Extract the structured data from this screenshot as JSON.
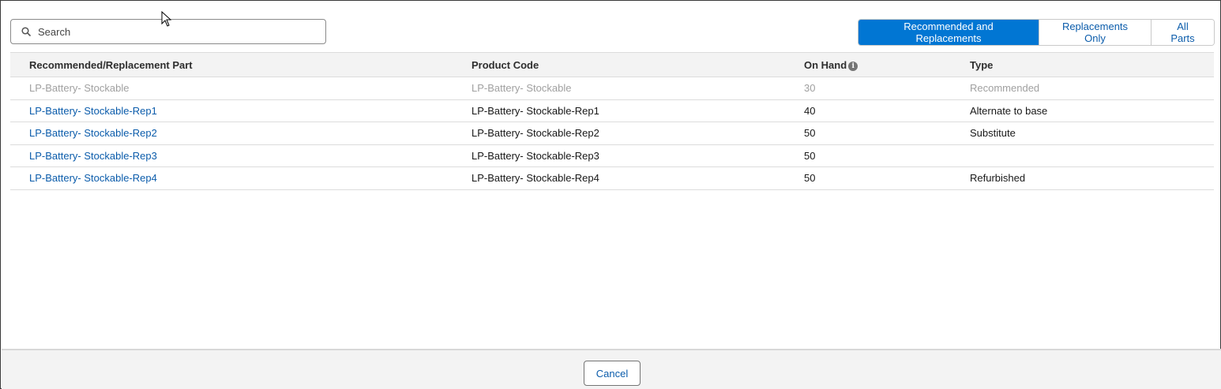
{
  "search": {
    "placeholder": "Search",
    "value": ""
  },
  "filters": {
    "options": [
      "Recommended and Replacements",
      "Replacements Only",
      "All Parts"
    ],
    "selected": "Recommended and Replacements"
  },
  "table": {
    "columns": [
      "Recommended/Replacement Part",
      "Product Code",
      "On Hand",
      "Type"
    ],
    "rows": [
      {
        "part": "LP-Battery- Stockable",
        "code": "LP-Battery- Stockable",
        "on_hand": "30",
        "type": "Recommended",
        "disabled": true
      },
      {
        "part": "LP-Battery- Stockable-Rep1",
        "code": "LP-Battery- Stockable-Rep1",
        "on_hand": "40",
        "type": "Alternate to base",
        "disabled": false
      },
      {
        "part": "LP-Battery- Stockable-Rep2",
        "code": "LP-Battery- Stockable-Rep2",
        "on_hand": "50",
        "type": "Substitute",
        "disabled": false
      },
      {
        "part": "LP-Battery- Stockable-Rep3",
        "code": "LP-Battery- Stockable-Rep3",
        "on_hand": "50",
        "type": "",
        "disabled": false
      },
      {
        "part": "LP-Battery- Stockable-Rep4",
        "code": "LP-Battery- Stockable-Rep4",
        "on_hand": "50",
        "type": "Refurbished",
        "disabled": false
      }
    ]
  },
  "footer": {
    "cancel_label": "Cancel"
  },
  "colors": {
    "brand": "#0176d3",
    "link": "#0b5cab",
    "disabled_text": "#a0a0a0"
  }
}
